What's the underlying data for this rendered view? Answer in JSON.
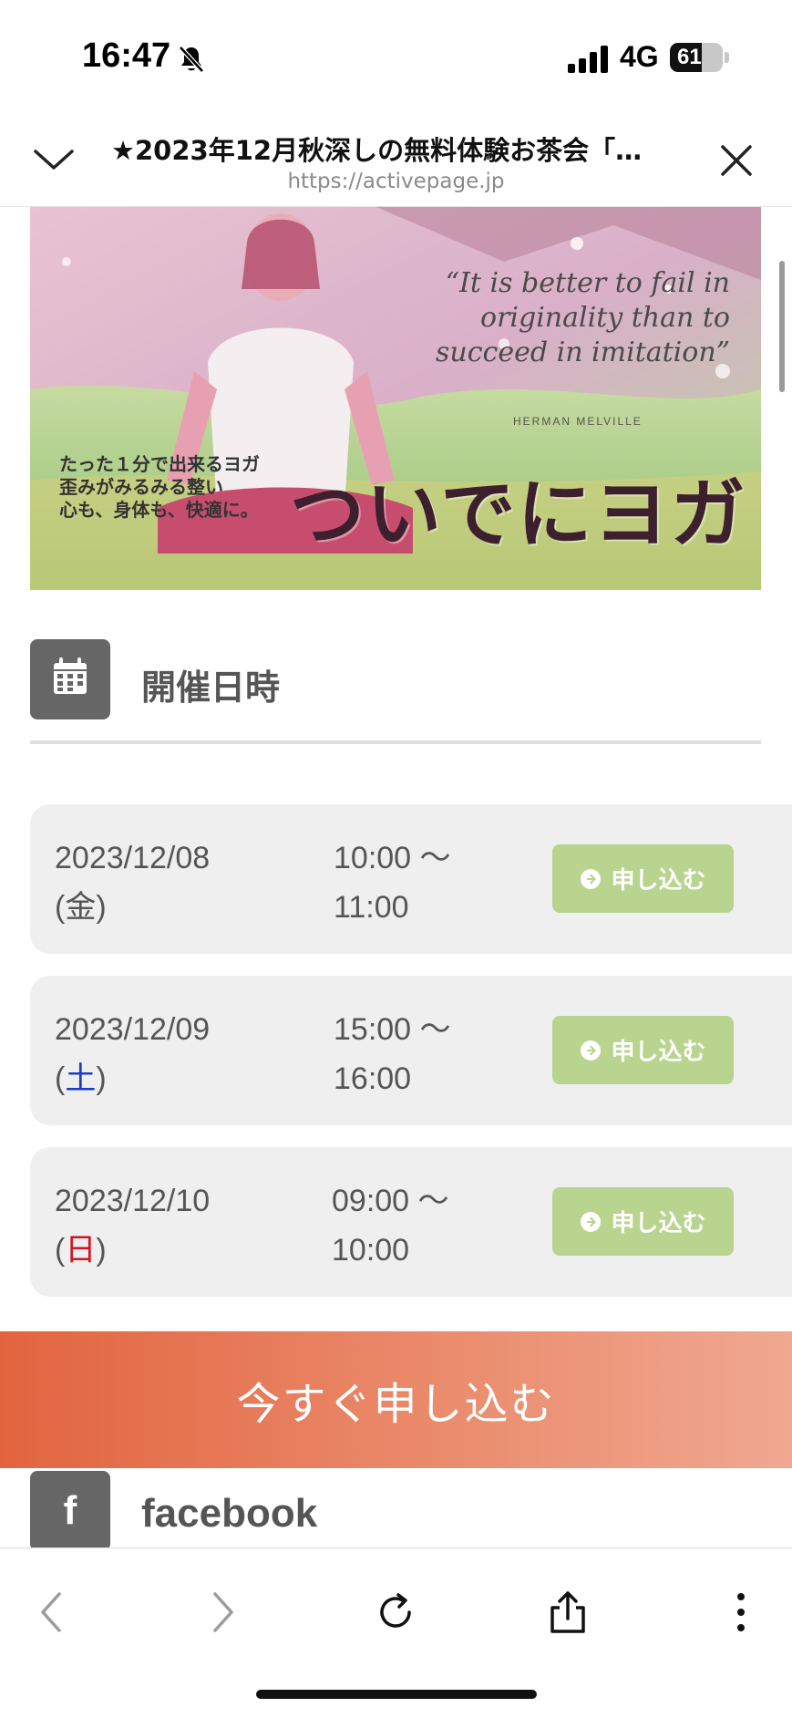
{
  "status_bar": {
    "time": "16:47",
    "network": "4G",
    "battery_percent": "61",
    "battery_level": 0.61
  },
  "browser": {
    "title": "★2023年12月秋深しの無料体験お茶会「…",
    "url": "https://activepage.jp"
  },
  "banner": {
    "quote": "“It is better to fail in originality than to succeed in imitation”",
    "quote_author": "HERMAN MELVILLE",
    "tagline": [
      "たった１分で出来るヨガ",
      "歪みがみるみる整い",
      "心も、身体も、快適に。"
    ],
    "title": "ついでにヨガ"
  },
  "section": {
    "title": "開催日時",
    "icon": "calendar-icon"
  },
  "schedule": [
    {
      "date": "2023/12/08",
      "wd_open": "(",
      "weekday": "金",
      "wd_close": ")",
      "weekday_type": "weekday",
      "time_start": "10:00 〜",
      "time_end": "11:00",
      "button_label": "申し込む"
    },
    {
      "date": "2023/12/09",
      "wd_open": "(",
      "weekday": "土",
      "wd_close": ")",
      "weekday_type": "saturday",
      "time_start": "15:00 〜",
      "time_end": "16:00",
      "button_label": "申し込む"
    },
    {
      "date": "2023/12/10",
      "wd_open": "(",
      "weekday": "日",
      "wd_close": ")",
      "weekday_type": "sunday",
      "time_start": "09:00 〜",
      "time_end": "10:00",
      "button_label": "申し込む"
    }
  ],
  "cta": {
    "label": "今すぐ申し込む"
  },
  "facebook": {
    "icon_letter": "f",
    "label": "facebook"
  },
  "toolbar": {
    "items": [
      "back-icon",
      "forward-icon",
      "reload-icon",
      "share-icon",
      "more-icon"
    ]
  },
  "colors": {
    "apply_button": "#b8d48f",
    "cta_start": "#e2643f",
    "cta_end": "#f0a891",
    "saturday": "#1a3cc8",
    "sunday": "#d4131f"
  }
}
